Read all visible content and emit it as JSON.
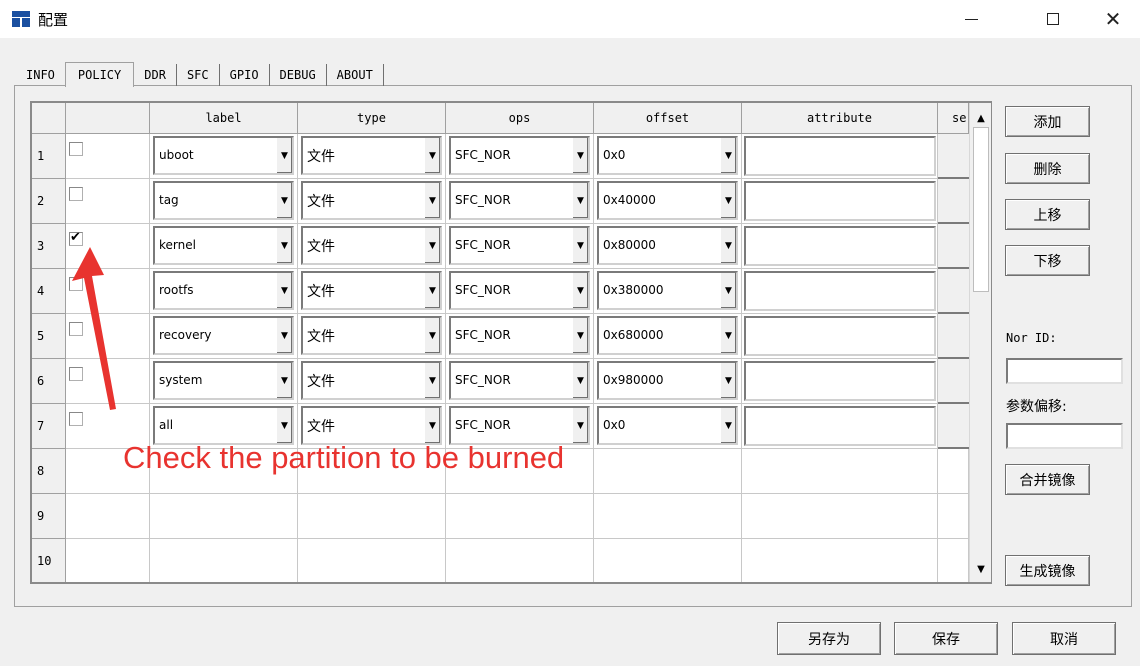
{
  "window": {
    "title": "配置",
    "minimize": "—",
    "close": "✕"
  },
  "tabs": [
    "INFO",
    "POLICY",
    "DDR",
    "SFC",
    "GPIO",
    "DEBUG",
    "ABOUT"
  ],
  "active_tab": "POLICY",
  "grid": {
    "columns": [
      "label",
      "type",
      "ops",
      "offset",
      "attribute",
      "se"
    ],
    "rows": [
      {
        "num": "1",
        "checked": false,
        "label": "uboot",
        "type": "文件",
        "ops": "SFC_NOR",
        "offset": "0x0"
      },
      {
        "num": "2",
        "checked": false,
        "label": "tag",
        "type": "文件",
        "ops": "SFC_NOR",
        "offset": "0x40000"
      },
      {
        "num": "3",
        "checked": true,
        "label": "kernel",
        "type": "文件",
        "ops": "SFC_NOR",
        "offset": "0x80000"
      },
      {
        "num": "4",
        "checked": false,
        "label": "rootfs",
        "type": "文件",
        "ops": "SFC_NOR",
        "offset": "0x380000"
      },
      {
        "num": "5",
        "checked": false,
        "label": "recovery",
        "type": "文件",
        "ops": "SFC_NOR",
        "offset": "0x680000"
      },
      {
        "num": "6",
        "checked": false,
        "label": "system",
        "type": "文件",
        "ops": "SFC_NOR",
        "offset": "0x980000"
      },
      {
        "num": "7",
        "checked": false,
        "label": "all",
        "type": "文件",
        "ops": "SFC_NOR",
        "offset": "0x0"
      },
      {
        "num": "8"
      },
      {
        "num": "9"
      },
      {
        "num": "10"
      }
    ]
  },
  "side": {
    "add": "添加",
    "delete": "删除",
    "move_up": "上移",
    "move_down": "下移",
    "nor_id_label": "Nor ID:",
    "param_offset_label": "参数偏移:",
    "merge_image": "合并镜像",
    "generate_image": "生成镜像"
  },
  "footer": {
    "save_as": "另存为",
    "save": "保存",
    "cancel": "取消"
  },
  "annotation": {
    "text": "Check the partition to be burned",
    "color": "#e8332f"
  }
}
